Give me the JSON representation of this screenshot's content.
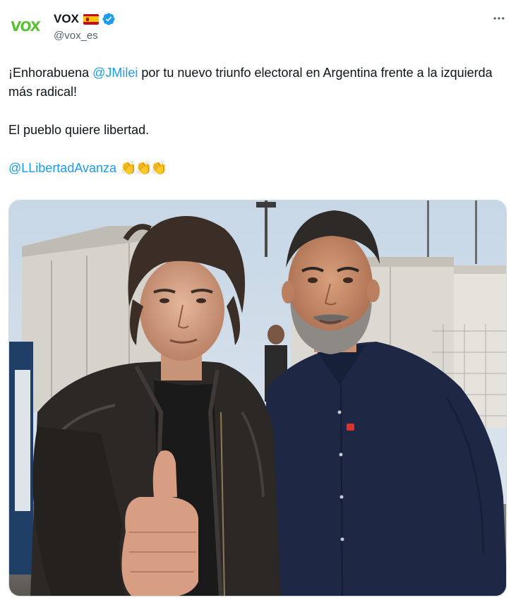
{
  "tweet": {
    "author": {
      "display_name": "VOX",
      "handle": "@vox_es",
      "avatar_text": "VOX",
      "flag_icon": "spain-flag-icon",
      "verified_icon": "verified-badge-icon"
    },
    "more_icon": "more-horizontal-icon",
    "text": {
      "line1_prefix": "¡Enhorabuena ",
      "line1_mention": "@JMilei",
      "line1_suffix": " por tu nuevo triunfo electoral en Argentina frente a la izquierda más radical!",
      "line2": "El pueblo quiere libertad.",
      "line3_mention": "@LLibertadAvanza",
      "line3_emoji": "👏👏👏"
    },
    "media": {
      "type": "photo"
    }
  },
  "colors": {
    "link": "#1d9bf0",
    "text_primary": "#0f1419",
    "text_secondary": "#536471",
    "vox_green": "#5ac035",
    "verified_blue": "#1d9bf0",
    "border": "#cfd9de"
  }
}
